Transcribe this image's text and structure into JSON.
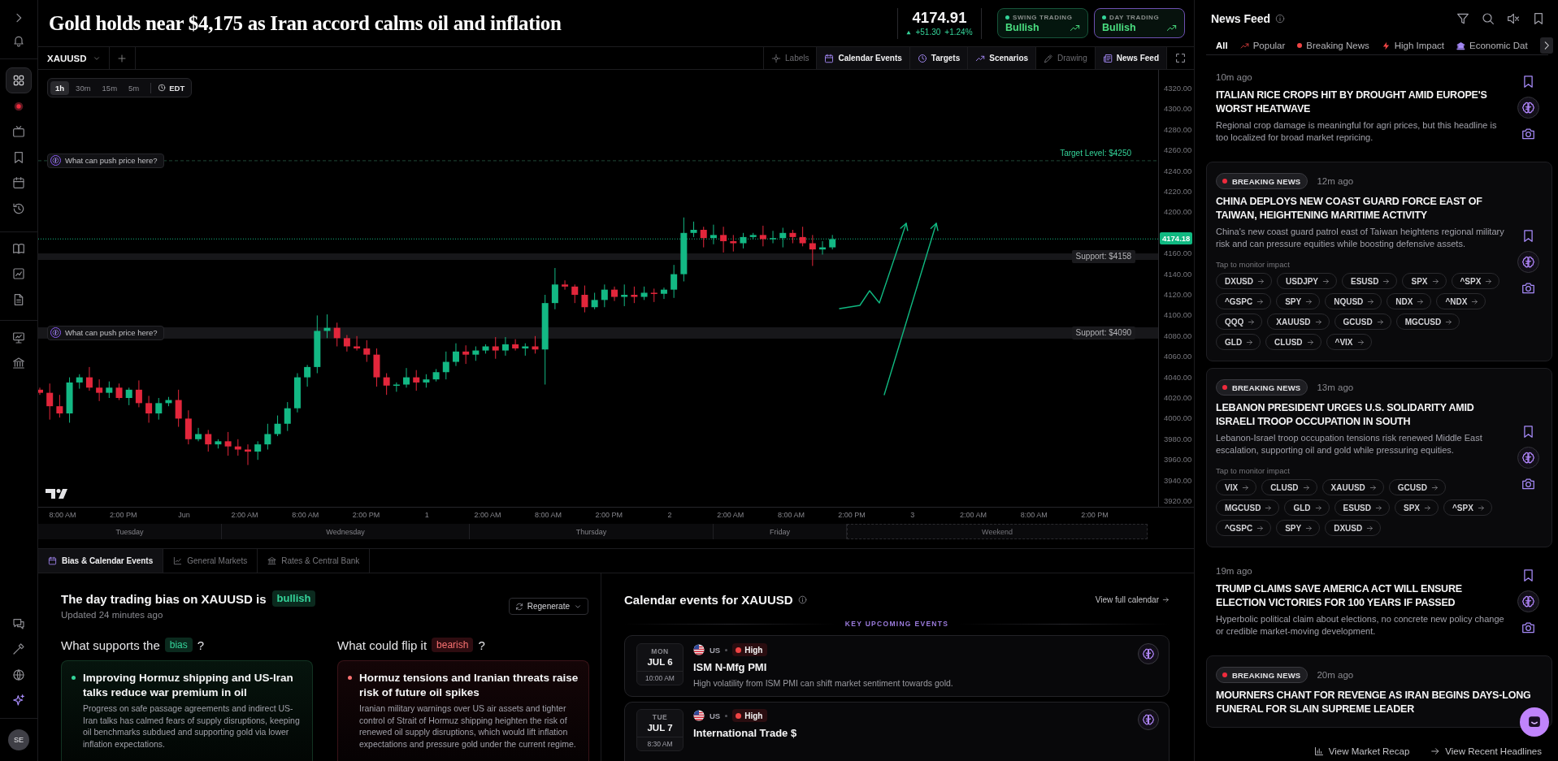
{
  "sidebar": {
    "groups": [
      {
        "items": [
          {
            "selected": false
          },
          {
            "selected": false
          }
        ]
      },
      {
        "items": [
          {
            "selected": true
          },
          {
            "selected": false
          },
          {
            "selected": false
          },
          {
            "selected": false
          },
          {
            "selected": false
          },
          {
            "selected": false
          }
        ]
      },
      {
        "items": [
          {
            "selected": false
          },
          {
            "selected": false
          },
          {
            "selected": false
          }
        ]
      },
      {
        "items": [
          {
            "selected": false
          },
          {
            "selected": false
          }
        ]
      }
    ],
    "bottom_items": [
      {
        "selected": false
      },
      {
        "selected": false
      },
      {
        "selected": false
      },
      {
        "selected": false
      }
    ],
    "avatar": "SE"
  },
  "header": {
    "headline": "Gold holds near $4,175 as Iran accord calms oil and inflation",
    "price": "4174.91",
    "rising": true,
    "change": "+51.30",
    "change_percent": "+1.24%",
    "modes": [
      {
        "label": "SWING TRADING",
        "value": "Bullish",
        "rising": true,
        "selected": false
      },
      {
        "label": "DAY TRADING",
        "value": "Bullish",
        "rising": true,
        "selected": true
      }
    ]
  },
  "chart_toolbar": {
    "symbol": "XAUUSD",
    "tools": [
      {
        "label": "Labels",
        "on": false
      },
      {
        "label": "Calendar Events",
        "on": true
      },
      {
        "label": "Targets",
        "on": true
      },
      {
        "label": "Scenarios",
        "on": true
      },
      {
        "label": "Drawing",
        "on": false
      },
      {
        "label": "News Feed",
        "on": true
      }
    ]
  },
  "chart": {
    "timeframes": [
      {
        "label": "1h",
        "selected": true
      },
      {
        "label": "30m",
        "selected": false
      },
      {
        "label": "15m",
        "selected": false
      },
      {
        "label": "5m",
        "selected": false
      }
    ],
    "timezone": "EDT",
    "levels": [
      {
        "kind": "target",
        "label": "Target Level: $4250",
        "prompt": "What can push price here?"
      },
      {
        "kind": "support",
        "label": "Support: $4158"
      },
      {
        "kind": "support",
        "label": "Support: $4090",
        "prompt": "What can push price here?"
      }
    ],
    "last_price": "4174.18",
    "price_axis": [
      "4320.00",
      "4300.00",
      "4280.00",
      "4260.00",
      "4240.00",
      "4220.00",
      "4200.00",
      "4160.00",
      "4140.00",
      "4120.00",
      "4100.00",
      "4080.00",
      "4060.00",
      "4040.00",
      "4020.00",
      "4000.00",
      "3980.00",
      "3960.00",
      "3940.00",
      "3920.00"
    ],
    "time_axis": [
      "8:00 AM",
      "2:00 PM",
      "Jun",
      "2:00 AM",
      "8:00 AM",
      "2:00 PM",
      "1",
      "2:00 AM",
      "8:00 AM",
      "2:00 PM",
      "2",
      "2:00 AM",
      "8:00 AM",
      "2:00 PM",
      "3",
      "2:00 AM",
      "8:00 AM",
      "2:00 PM"
    ],
    "sessions": [
      {
        "label": "Tuesday",
        "kind": "weekday"
      },
      {
        "label": "Wednesday",
        "kind": "weekday"
      },
      {
        "label": "Thursday",
        "kind": "weekday"
      },
      {
        "label": "Friday",
        "kind": "weekday"
      },
      {
        "label": "Weekend",
        "kind": "weekend"
      }
    ]
  },
  "bottom_tabs": [
    {
      "label": "Bias & Calendar Events",
      "selected": true
    },
    {
      "label": "General Markets",
      "selected": false
    },
    {
      "label": "Rates & Central Bank",
      "selected": false
    }
  ],
  "bias": {
    "heading": "The day trading bias on XAUUSD is",
    "bias": {
      "label": "bullish",
      "kind": "bullish"
    },
    "updated": "Updated 24 minutes ago",
    "regenerate": "Regenerate",
    "columns": [
      {
        "prompt": "What supports the",
        "tag": "bias",
        "kind": "bullish",
        "suffix": "?",
        "factors": [
          {
            "title": "Improving Hormuz shipping and US-Iran talks reduce war premium in oil",
            "body": "Progress on safe passage agreements and indirect US-Iran talks has calmed fears of supply disruptions, keeping oil benchmarks subdued and supporting gold via lower inflation expectations."
          }
        ]
      },
      {
        "prompt": "What could flip it",
        "tag": "bearish",
        "kind": "bearish",
        "suffix": "?",
        "factors": [
          {
            "title": "Hormuz tensions and Iranian threats raise risk of future oil spikes",
            "body": "Iranian military warnings over US air assets and tighter control of Strait of Hormuz shipping heighten the risk of renewed oil supply disruptions, which would lift inflation expectations and pressure gold under the current regime."
          }
        ]
      }
    ]
  },
  "calendar": {
    "title": "Calendar events for XAUUSD",
    "link": "View full calendar",
    "section": "KEY UPCOMING EVENTS",
    "events": [
      {
        "weekday": "MON",
        "date": "JUL 6",
        "time": "10:00 AM",
        "country": "US",
        "impact": {
          "label": "High",
          "kind": "high"
        },
        "title": "ISM N-Mfg PMI",
        "description": "High volatility from ISM PMI can shift market sentiment towards gold."
      },
      {
        "weekday": "TUE",
        "date": "JUL 7",
        "time": "8:30 AM",
        "country": "US",
        "impact": {
          "label": "High",
          "kind": "high"
        },
        "title": "International Trade $"
      }
    ]
  },
  "news_feed": {
    "title": "News Feed",
    "filters": [
      {
        "label": "All",
        "kind": "all",
        "selected": true
      },
      {
        "label": "Popular",
        "kind": "popular",
        "selected": false
      },
      {
        "label": "Breaking News",
        "kind": "breaking",
        "selected": false
      },
      {
        "label": "High Impact",
        "kind": "high_impact",
        "selected": false
      },
      {
        "label": "Economic Dat",
        "kind": "economic",
        "selected": false
      }
    ],
    "items": [
      {
        "kind": "standard",
        "time": "10m ago",
        "title": "ITALIAN RICE CROPS HIT BY DROUGHT AMID EUROPE'S WORST HEATWAVE",
        "summary": "Regional crop damage is meaningful for agri prices, but this headline is too localized for broad market repricing."
      },
      {
        "kind": "breaking",
        "badge": "BREAKING NEWS",
        "time": "12m ago",
        "title": "CHINA DEPLOYS NEW COAST GUARD FORCE EAST OF TAIWAN, HEIGHTENING MARITIME ACTIVITY",
        "summary": "China's new coast guard patrol east of Taiwan heightens regional military risk and can pressure equities while boosting defensive assets.",
        "impact_hint": "Tap to monitor impact",
        "tickers": [
          "DXUSD",
          "USDJPY",
          "ESUSD",
          "SPX",
          "^SPX",
          "^GSPC",
          "SPY",
          "NQUSD",
          "NDX",
          "^NDX",
          "QQQ",
          "XAUUSD",
          "GCUSD",
          "MGCUSD",
          "GLD",
          "CLUSD",
          "^VIX"
        ]
      },
      {
        "kind": "breaking",
        "badge": "BREAKING NEWS",
        "time": "13m ago",
        "title": "LEBANON PRESIDENT URGES U.S. SOLIDARITY AMID ISRAELI TROOP OCCUPATION IN SOUTH",
        "summary": "Lebanon-Israel troop occupation tensions risk renewed Middle East escalation, supporting oil and gold while pressuring equities.",
        "impact_hint": "Tap to monitor impact",
        "tickers": [
          "VIX",
          "CLUSD",
          "XAUUSD",
          "GCUSD",
          "MGCUSD",
          "GLD",
          "ESUSD",
          "SPX",
          "^SPX",
          "^GSPC",
          "SPY",
          "DXUSD"
        ]
      },
      {
        "kind": "standard",
        "time": "19m ago",
        "title": "TRUMP CLAIMS SAVE AMERICA ACT WILL ENSURE ELECTION VICTORIES FOR 100 YEARS IF PASSED",
        "summary": "Hyperbolic political claim about elections, no concrete new policy change or credible market-moving development."
      },
      {
        "kind": "breaking",
        "badge": "BREAKING NEWS",
        "time": "20m ago",
        "title": "MOURNERS CHANT FOR REVENGE AS IRAN BEGINS DAYS-LONG FUNERAL FOR SLAIN SUPREME LEADER"
      }
    ],
    "footer": [
      {
        "label": "View Market Recap",
        "kind": "recap"
      },
      {
        "label": "View Recent Headlines",
        "kind": "headlines"
      }
    ]
  }
}
